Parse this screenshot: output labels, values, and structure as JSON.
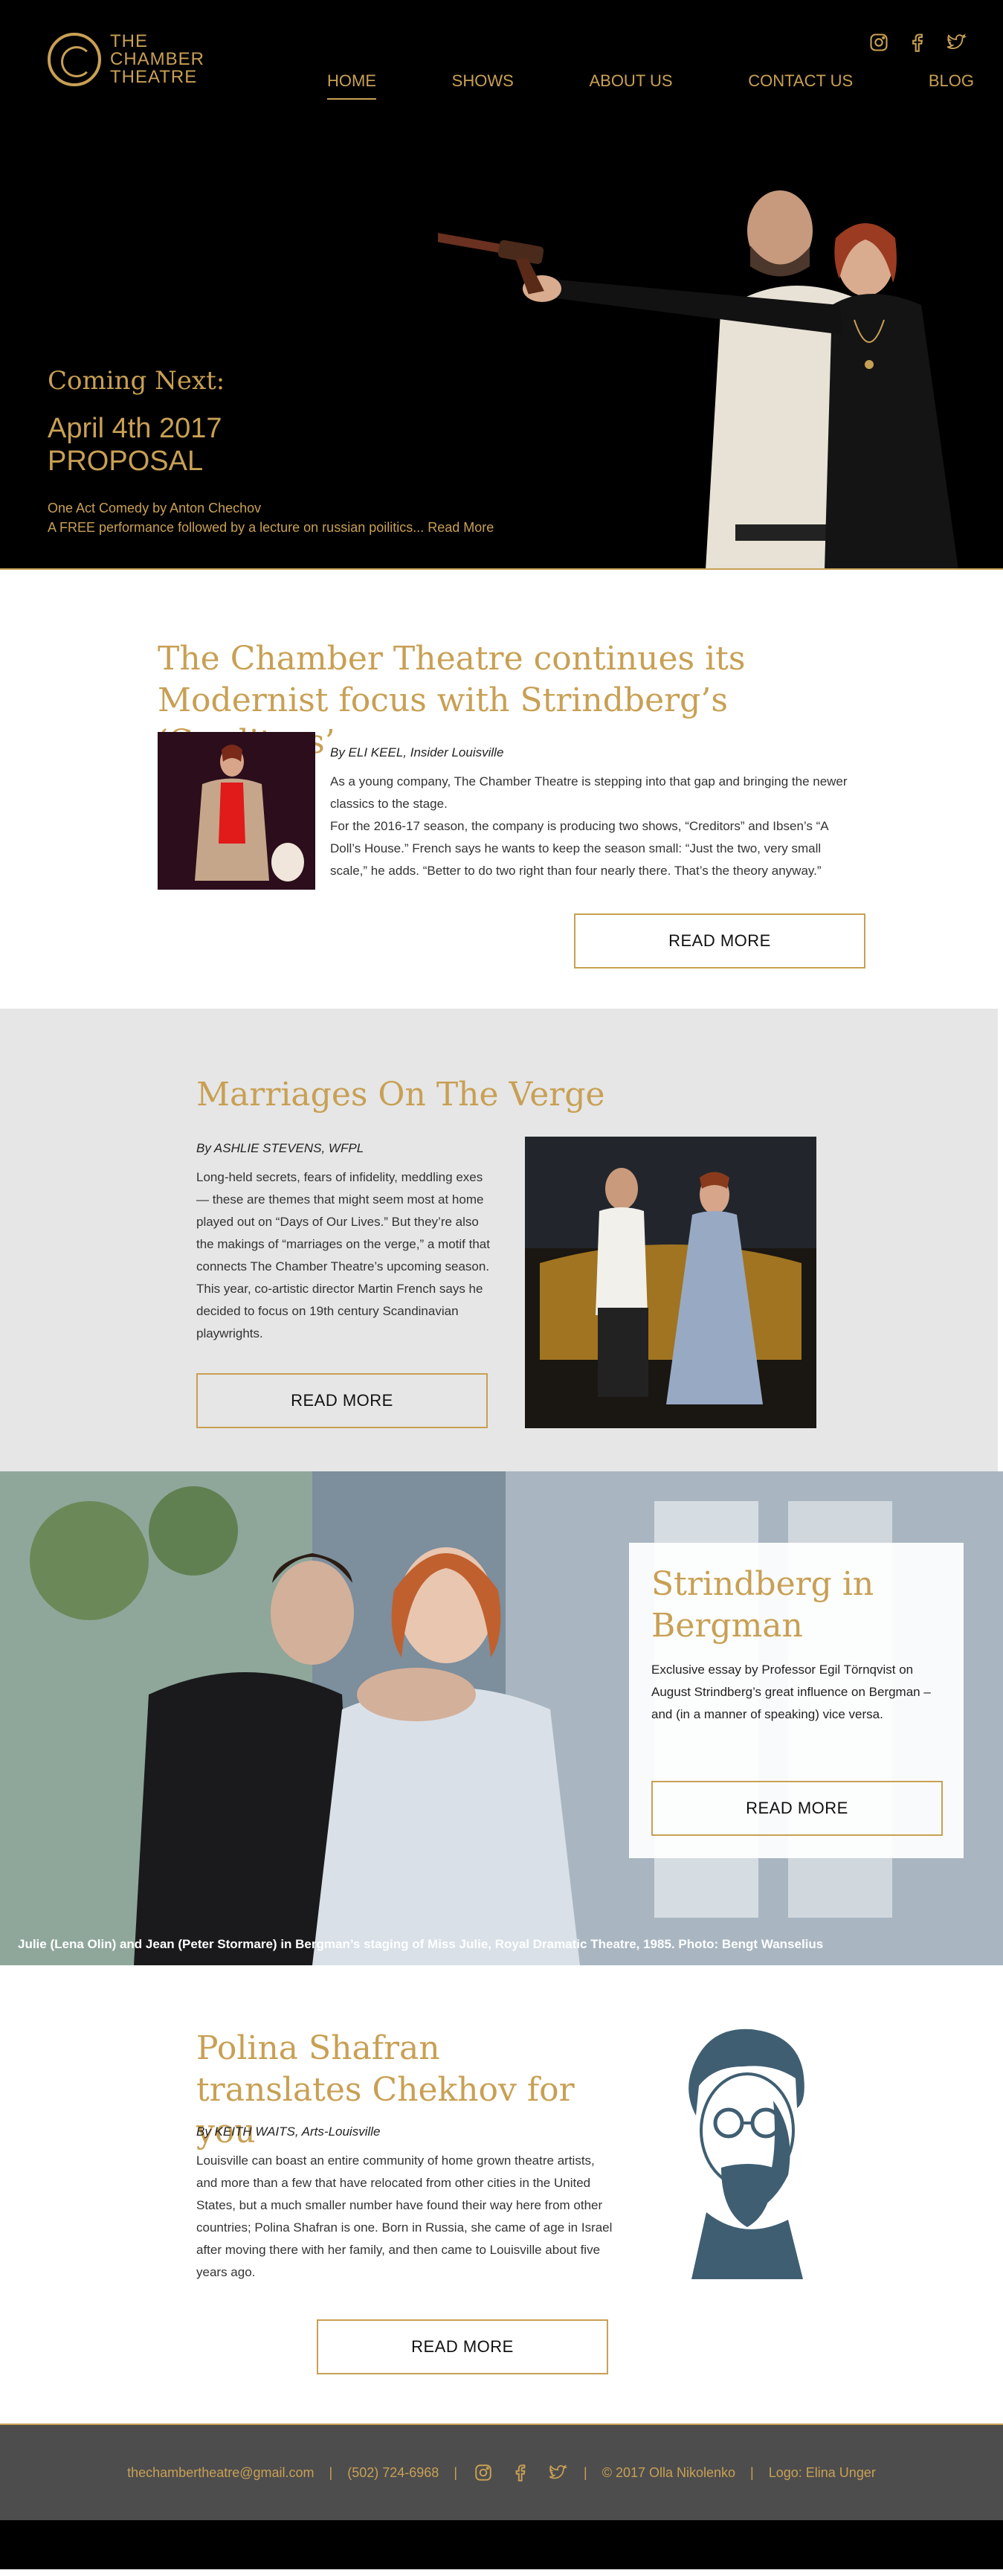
{
  "logo": {
    "line1": "THE",
    "line2": "CHAMBER",
    "line3": "THEATRE"
  },
  "nav": {
    "items": [
      {
        "label": "HOME"
      },
      {
        "label": "SHOWS"
      },
      {
        "label": "ABOUT US"
      },
      {
        "label": "CONTACT US"
      },
      {
        "label": "BLOG"
      }
    ]
  },
  "social": [
    "instagram-icon",
    "facebook-icon",
    "twitter-icon"
  ],
  "hero": {
    "coming": "Coming Next:",
    "date": "April 4th 2017",
    "show": "PROPOSAL",
    "sub1": "One Act Comedy by Anton Chechov",
    "sub2": "A FREE performance followed by a lecture on russian poilitics...",
    "read_more": "Read More"
  },
  "article1": {
    "title": "The Chamber Theatre continues its Modernist focus with Strindberg’s ‘Creditors’",
    "byline": "By ELI KEEL, Insider Louisville",
    "p1": "As a young company, The Chamber Theatre is stepping into that gap and bringing the newer classics to the stage.",
    "p2": "For the 2016-17 season, the company is producing two shows, “Creditors” and Ibsen’s “A Doll’s House.” French says he wants to keep the season small: “Just the two, very small scale,” he adds. “Better to do two right than four nearly there. That’s the theory anyway.”",
    "button": "READ MORE"
  },
  "article2": {
    "title": "Marriages On The Verge",
    "byline": "By ASHLIE STEVENS, WFPL",
    "body": "Long-held secrets, fears of infidelity, meddling exes — these are themes that might seem most at home played out on “Days of Our Lives.” But they’re also the makings of “marriages on the verge,” a motif that connects The Chamber Theatre’s upcoming season. This year, co-artistic director Martin French says he decided to focus on 19th century Scandinavian playwrights.",
    "button": "READ MORE"
  },
  "article3": {
    "title": "Strindberg in Bergman",
    "body": "Exclusive essay by Professor Egil Törnqvist on August Strindberg’s great influence on Bergman – and (in a manner of speaking) vice versa.",
    "button": "READ MORE",
    "caption": "Julie (Lena Olin) and Jean (Peter Stormare)  in Bergman’s staging of Miss Julie, Royal Dramatic Theatre, 1985. Photo: Bengt Wanselius"
  },
  "article4": {
    "title": "Polina Shafran translates Chekhov for you",
    "byline": "By KEITH WAITS, Arts-Louisville",
    "body": "Louisville can boast an entire community of home grown theatre artists, and more than a few that have relocated from other cities in the United States, but a much smaller number have found their way here from other countries; Polina Shafran is one. Born in Russia, she came of age in Israel after moving there with her family, and then came to Louisville about five years ago.",
    "button": "READ MORE"
  },
  "footer": {
    "email": "thechambertheatre@gmail.com",
    "phone": "(502) 724-6968",
    "copyright": "© 2017 Olla Nikolenko",
    "logo_credit": "Logo: Elina Unger",
    "separator": "|"
  },
  "colors": {
    "gold": "#c8a054",
    "dark": "#000000",
    "footer": "#4d4d4d",
    "gray_section": "#e6e6e6"
  }
}
